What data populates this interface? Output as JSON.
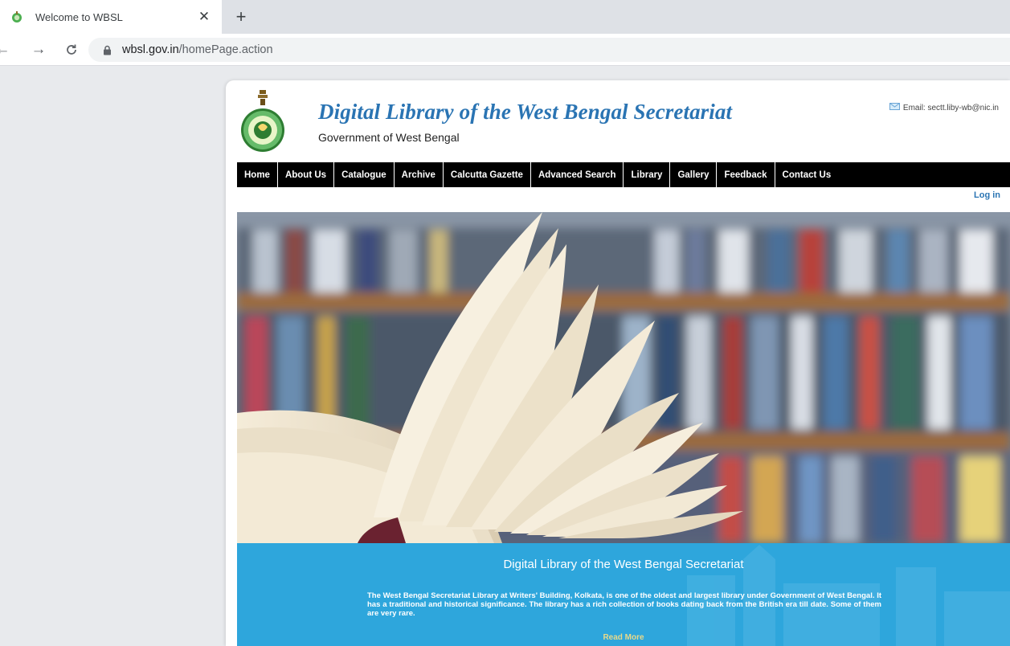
{
  "browser": {
    "tab_title": "Welcome to WBSL",
    "url_host": "wbsl.gov.in",
    "url_path": "/homePage.action"
  },
  "header": {
    "title": "Digital Library of the West Bengal Secretariat",
    "subtitle": "Government of West Bengal",
    "email": "Email: sectt.liby-wb@nic.in"
  },
  "nav": {
    "items": [
      "Home",
      "About Us",
      "Catalogue",
      "Archive",
      "Calcutta Gazette",
      "Advanced Search",
      "Library",
      "Gallery",
      "Feedback",
      "Contact Us"
    ],
    "login": "Log in"
  },
  "intro": {
    "title": "Digital Library of the West Bengal Secretariat",
    "text": "The West Bengal Secretariat Library at Writers' Building, Kolkata, is one of the oldest and largest library under Government of West Bengal. It has a traditional and historical significance. The library has a rich collection of books dating back from the British era till date. Some of them are very rare.",
    "read_more": "Read More"
  },
  "colors": {
    "title_blue": "#2a74b3",
    "nav_bg": "#000000",
    "intro_bg": "#2ea6dc"
  }
}
